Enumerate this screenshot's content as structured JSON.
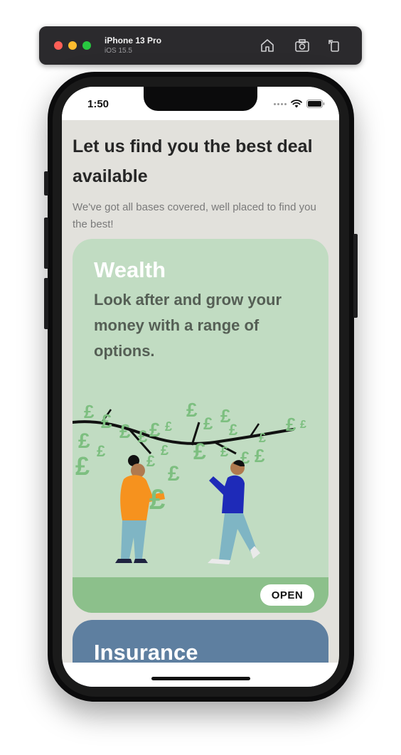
{
  "simulator": {
    "device_name": "iPhone 13 Pro",
    "os_version": "iOS 15.5",
    "buttons": [
      "home-icon",
      "screenshot-icon",
      "rotate-icon"
    ]
  },
  "status_bar": {
    "time": "1:50"
  },
  "page": {
    "headline": "Let us find you the best deal available",
    "subheadline": "We've got all bases covered, well placed to find you the best!"
  },
  "cards": {
    "wealth": {
      "title": "Wealth",
      "description": "Look after and grow your money with a range of options.",
      "open_label": "OPEN",
      "background": "#c1dcc2",
      "footer_color": "#8cc08b"
    },
    "insurance": {
      "title": "Insurance",
      "background": "#5e7fa0"
    }
  },
  "colors": {
    "app_background": "#e2e1dc",
    "title_text": "#262626",
    "subtitle_text": "#7a7a7a"
  }
}
